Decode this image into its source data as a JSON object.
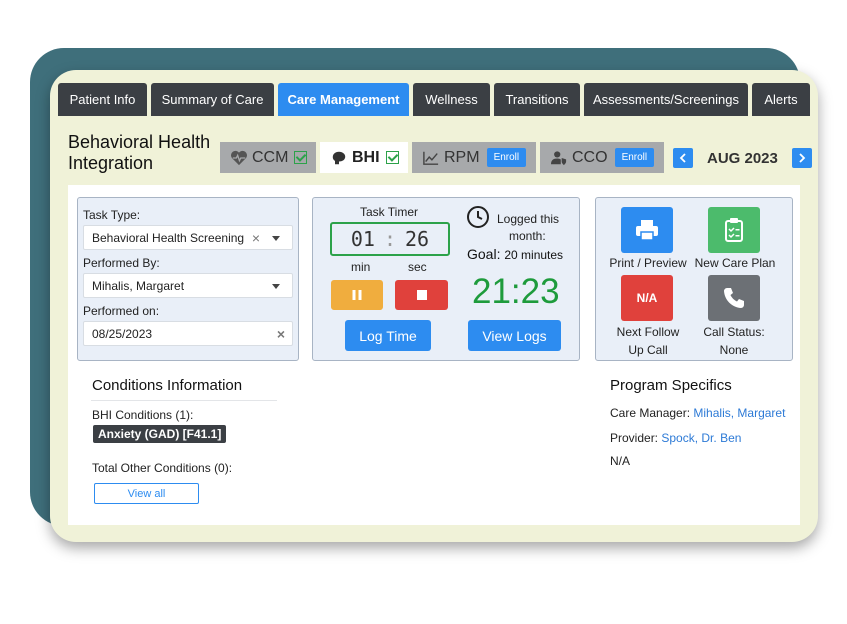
{
  "tabs": [
    {
      "label": "Patient Info"
    },
    {
      "label": "Summary of Care"
    },
    {
      "label": "Care Management"
    },
    {
      "label": "Wellness"
    },
    {
      "label": "Transitions"
    },
    {
      "label": "Assessments/Screenings"
    },
    {
      "label": "Alerts"
    }
  ],
  "page_title_line1": "Behavioral Health",
  "page_title_line2": "Integration",
  "programs": {
    "ccm": {
      "label": "CCM"
    },
    "bhi": {
      "label": "BHI"
    },
    "rpm": {
      "label": "RPM",
      "enroll": "Enroll"
    },
    "cco": {
      "label": "CCO",
      "enroll": "Enroll"
    }
  },
  "month": "AUG 2023",
  "task_form": {
    "task_type_label": "Task Type:",
    "task_type_value": "Behavioral Health Screening",
    "performed_by_label": "Performed By:",
    "performed_by_value": "Mihalis, Margaret",
    "performed_on_label": "Performed on:",
    "performed_on_value": "08/25/2023"
  },
  "timer": {
    "title": "Task Timer",
    "minutes": "01",
    "separator": ":",
    "seconds": "26",
    "min_label": "min",
    "sec_label": "sec",
    "logged_line1": "Logged this",
    "logged_line2": "month:",
    "goal_label": "Goal:",
    "goal_value": "20 minutes",
    "logged_time": "21:23",
    "log_time_button": "Log Time",
    "view_logs_button": "View Logs"
  },
  "actions": {
    "print_label": "Print / Preview",
    "new_care_plan_label": "New Care Plan",
    "na_badge": "N/A",
    "next_follow_line1": "Next Follow",
    "next_follow_line2": "Up Call",
    "call_status_line1": "Call Status:",
    "call_status_line2": "None"
  },
  "conditions": {
    "title": "Conditions Information",
    "bhi_label": "BHI Conditions (1):",
    "bhi_tag": "Anxiety (GAD) [F41.1]",
    "other_label": "Total Other Conditions (0):",
    "view_all": "View all"
  },
  "program_specifics": {
    "title": "Program Specifics",
    "care_manager_label": "Care Manager:",
    "care_manager_value": "Mihalis, Margaret",
    "provider_label": "Provider:",
    "provider_value": "Spock, Dr. Ben",
    "extra": "N/A"
  },
  "colors": {
    "accent": "#2d8cf0",
    "timer_green": "#1e9b3c",
    "pause_orange": "#f0ad3e",
    "stop_red": "#e0413c",
    "print_blue": "#2d8cf0",
    "care_plan_green": "#4cbb6c",
    "na_red": "#e0413c",
    "call_gray": "#6c7075",
    "tab_dark": "#3b3f44",
    "frame_teal": "#3f6f7b"
  },
  "icons": [
    "heart-pulse-icon",
    "brain-icon",
    "chart-line-icon",
    "user-shield-icon",
    "clock-icon",
    "pause-icon",
    "stop-icon",
    "printer-icon",
    "clipboard-check-icon",
    "phone-icon",
    "chevron-left-icon",
    "chevron-right-icon",
    "caret-down-icon",
    "close-icon"
  ]
}
